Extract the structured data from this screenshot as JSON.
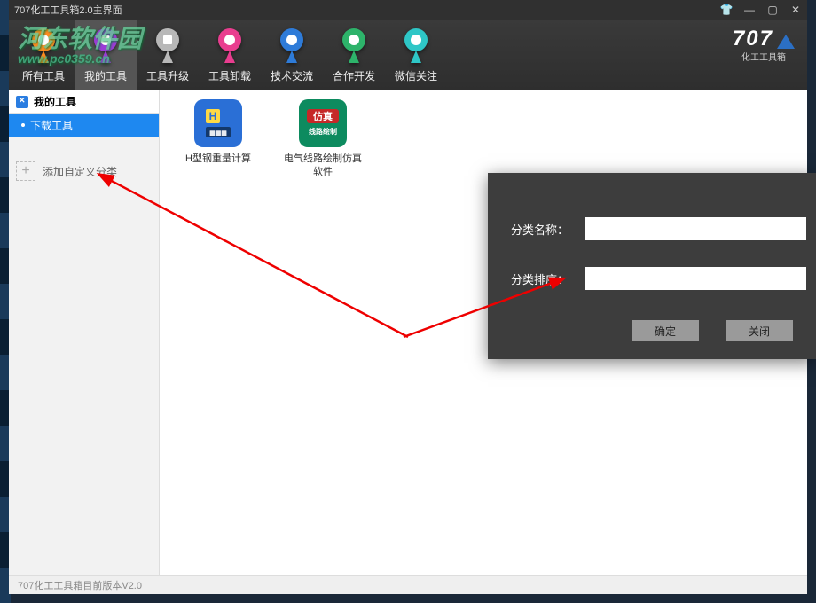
{
  "title": "707化工工具箱2.0主界面",
  "watermark": {
    "name": "河东软件园",
    "url": "www.pc0359.cn"
  },
  "brand": {
    "num": "707",
    "sub": "化工工具箱"
  },
  "toolbar": [
    {
      "label": "所有工具",
      "key": "all-tools"
    },
    {
      "label": "我的工具",
      "key": "my-tools"
    },
    {
      "label": "工具升级",
      "key": "upgrade"
    },
    {
      "label": "工具卸载",
      "key": "uninstall"
    },
    {
      "label": "技术交流",
      "key": "forum"
    },
    {
      "label": "合作开发",
      "key": "cooperate"
    },
    {
      "label": "微信关注",
      "key": "wechat"
    }
  ],
  "sidebar": {
    "header": "我的工具",
    "items": [
      {
        "label": "下载工具",
        "selected": true
      }
    ],
    "add_label": "添加自定义分类"
  },
  "apps": [
    {
      "label": "H型钢重量计算",
      "key": "hsteel"
    },
    {
      "label": "电气线路绘制仿真软件",
      "key": "circuit"
    }
  ],
  "dialog": {
    "field1_label": "分类名称：",
    "field2_label": "分类排序：",
    "field1_value": "",
    "field2_value": "",
    "ok": "确定",
    "close": "关闭"
  },
  "statusbar": "707化工工具箱目前版本V2.0"
}
